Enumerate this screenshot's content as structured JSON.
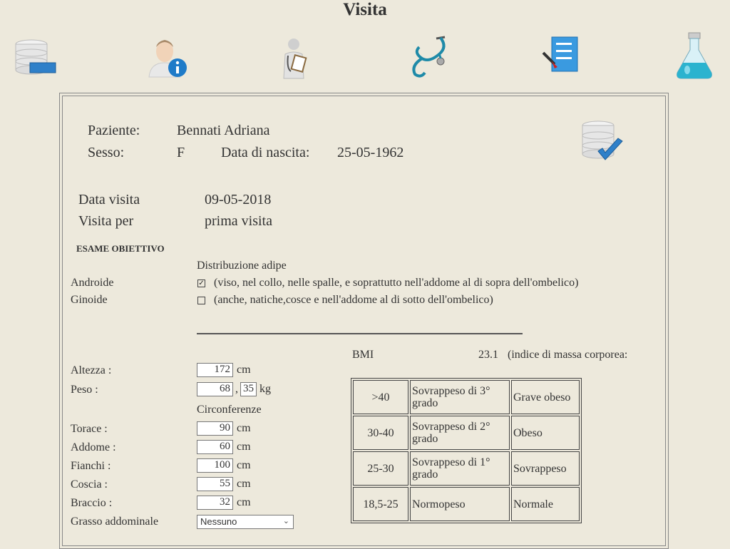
{
  "title": "Visita",
  "toolbar": {
    "icons": [
      "database-icon",
      "user-info-icon",
      "doctor-icon",
      "stethoscope-icon",
      "checklist-icon",
      "lab-flask-icon"
    ]
  },
  "patient": {
    "patient_label": "Paziente:",
    "patient_name": "Bennati Adriana",
    "sex_label": "Sesso:",
    "sex_value": "F",
    "dob_label": "Data di nascita:",
    "dob_value": "25-05-1962"
  },
  "visit": {
    "date_label": "Data visita",
    "date_value": "09-05-2018",
    "reason_label": "Visita per",
    "reason_value": "prima visita"
  },
  "exam": {
    "section_title": "ESAME OBIETTIVO",
    "fat_distribution_label": "Distribuzione adipe",
    "android_label": "Androide",
    "android_checked": true,
    "android_desc": "(viso, nel collo, nelle spalle, e soprattutto nell'addome al di sopra dell'ombelico)",
    "gynoid_label": "Ginoide",
    "gynoid_checked": false,
    "gynoid_desc": "(anche, natiche,cosce e nell'addome al di sotto dell'ombelico)"
  },
  "measures": {
    "height_label": "Altezza :",
    "height_value": "172",
    "height_unit": "cm",
    "weight_label": "Peso :",
    "weight_int": "68",
    "weight_sep": ",",
    "weight_dec": "35",
    "weight_unit": "kg",
    "circ_label": "Circonferenze",
    "chest_label": "Torace :",
    "chest_value": "90",
    "abdomen_label": "Addome :",
    "abdomen_value": "60",
    "hips_label": "Fianchi :",
    "hips_value": "100",
    "thigh_label": "Coscia :",
    "thigh_value": "55",
    "arm_label": "Braccio :",
    "arm_value": "32",
    "cm": "cm",
    "abdominal_fat_label": "Grasso addominale",
    "abdominal_fat_value": "Nessuno"
  },
  "bmi": {
    "label": "BMI",
    "value": "23.1",
    "desc": "(indice di massa corporea:",
    "table": [
      {
        "range": ">40",
        "desc": "Sovrappeso di 3° grado",
        "class": "Grave obeso"
      },
      {
        "range": "30-40",
        "desc": "Sovrappeso di 2° grado",
        "class": "Obeso"
      },
      {
        "range": "25-30",
        "desc": "Sovrappeso di 1° grado",
        "class": "Sovrappeso"
      },
      {
        "range": "18,5-25",
        "desc": "Normopeso",
        "class": "Normale"
      }
    ]
  }
}
